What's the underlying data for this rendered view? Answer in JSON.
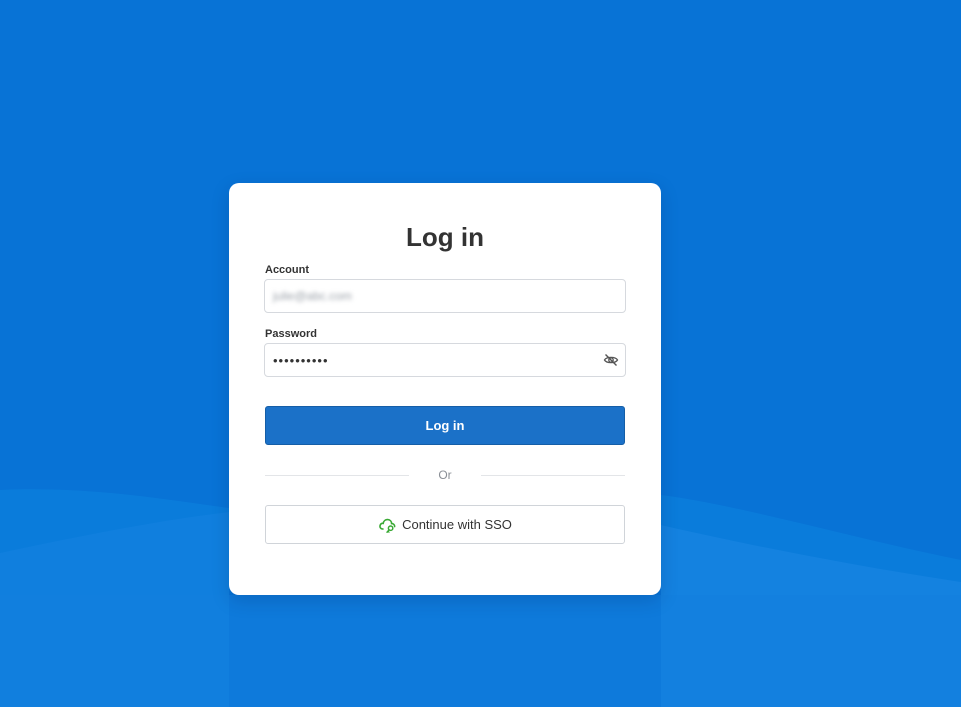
{
  "login": {
    "title": "Log in",
    "account_label": "Account",
    "account_value": "julie@abc.com",
    "password_label": "Password",
    "password_value": "••••••••••",
    "submit_label": "Log in",
    "divider_text": "Or",
    "sso_label": "Continue with SSO"
  },
  "icons": {
    "password_toggle": "eye-off-icon",
    "sso": "cloud-key-icon"
  },
  "colors": {
    "background": "#0873d6",
    "primary_button": "#1b71c8",
    "sso_icon": "#3aa935"
  }
}
